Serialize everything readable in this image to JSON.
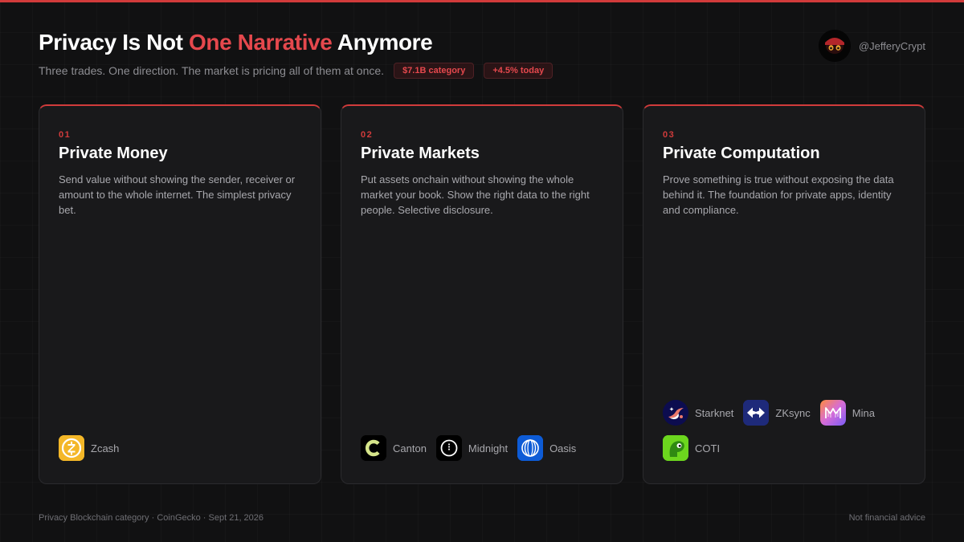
{
  "header": {
    "title_prefix": "Privacy Is Not ",
    "title_accent": "One Narrative",
    "title_suffix": " Anymore",
    "subtitle": "Three trades. One direction. The market is pricing all of them at once.",
    "badges": [
      "$7.1B category",
      "+4.5% today"
    ]
  },
  "author": {
    "handle": "@JefferyCrypt",
    "avatar_icon": "avatar-icon"
  },
  "cards": [
    {
      "number": "01",
      "title": "Private Money",
      "description": "Send value without showing the sender, receiver or amount to the whole internet. The simplest privacy bet.",
      "projects": [
        {
          "name": "Zcash",
          "icon": "zcash-logo-icon"
        }
      ]
    },
    {
      "number": "02",
      "title": "Private Markets",
      "description": "Put assets onchain without showing the whole market your book. Show the right data to the right people. Selective disclosure.",
      "projects": [
        {
          "name": "Canton",
          "icon": "canton-logo-icon"
        },
        {
          "name": "Midnight",
          "icon": "midnight-logo-icon"
        },
        {
          "name": "Oasis",
          "icon": "oasis-logo-icon"
        }
      ]
    },
    {
      "number": "03",
      "title": "Private Computation",
      "description": "Prove something is true without exposing the data behind it. The foundation for private apps, identity and compliance.",
      "projects": [
        {
          "name": "Starknet",
          "icon": "starknet-logo-icon"
        },
        {
          "name": "ZKsync",
          "icon": "zksync-logo-icon"
        },
        {
          "name": "Mina",
          "icon": "mina-logo-icon"
        },
        {
          "name": "COTI",
          "icon": "coti-logo-icon"
        }
      ]
    }
  ],
  "footer": {
    "source": "Privacy Blockchain category · CoinGecko · Sept 21, 2026",
    "disclaimer": "Not financial advice"
  },
  "colors": {
    "accent": "#d13b3b",
    "accent_text": "#e5484d",
    "background": "#111112",
    "card": "#19191b"
  }
}
